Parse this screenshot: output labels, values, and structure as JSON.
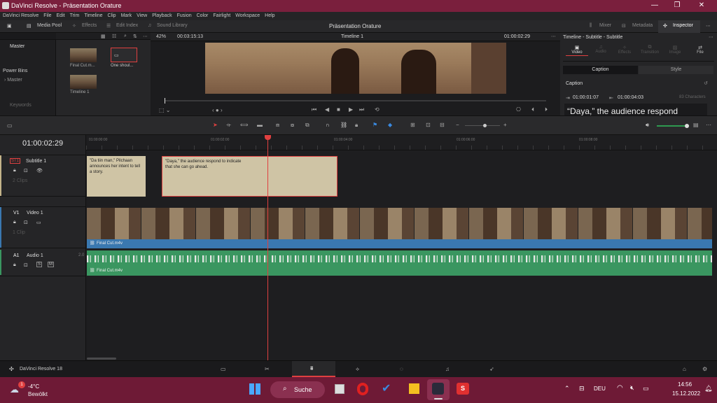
{
  "window": {
    "title": "DaVinci Resolve - Präsentation Orature"
  },
  "menu": [
    "DaVinci Resolve",
    "File",
    "Edit",
    "Trim",
    "Timeline",
    "Clip",
    "Mark",
    "View",
    "Playback",
    "Fusion",
    "Color",
    "Fairlight",
    "Workspace",
    "Help"
  ],
  "toolbar": {
    "media_pool": "Media Pool",
    "effects": "Effects",
    "edit_index": "Edit Index",
    "sound_library": "Sound Library",
    "project_name": "Präsentation Orature",
    "mixer": "Mixer",
    "metadata": "Metadata",
    "inspector": "Inspector"
  },
  "left_panel": {
    "master": "Master",
    "power_bins": "Power Bins",
    "power_master": "Master",
    "keywords": "Keywords"
  },
  "media_pool": {
    "items": [
      {
        "label": "Final Cut.m..."
      },
      {
        "label": "One shoul..."
      },
      {
        "label": "Timeline 1"
      }
    ]
  },
  "viewer": {
    "zoom": "42%",
    "timecode_left": "00:03:15:13",
    "timeline_name": "Timeline 1",
    "timecode_right": "01:00:02:29"
  },
  "inspector": {
    "header": "Timeline - Subtitle - Subtitle",
    "tabs": [
      "Video",
      "Audio",
      "Effects",
      "Transition",
      "Image",
      "File"
    ],
    "sub_tabs": [
      "Caption",
      "Style"
    ],
    "section": "Caption",
    "in_tc": "01:00:01:07",
    "out_tc": "01:00:04:03",
    "chars": "83 Characters",
    "caption_text": "“Daya,” the audience respond"
  },
  "timeline": {
    "current_tc": "01:00:02:29",
    "ruler": [
      "01:00:00:00",
      "01:00:02:00",
      "01:00:04:00",
      "01:00:06:00",
      "01:00:08:00"
    ],
    "tracks": {
      "subtitle": {
        "id": "ST1",
        "name": "Subtitle 1",
        "clips": "2 Clips"
      },
      "video": {
        "id": "V1",
        "name": "Video 1",
        "clips": "1 Clip"
      },
      "audio": {
        "id": "A1",
        "name": "Audio 1",
        "channels": "2.0"
      }
    },
    "subtitle_clips": [
      {
        "text": "\"Da tiin man,\" Pilchaan announces her intent to tell a story."
      },
      {
        "text": "\"Daya,\" the audience respond to indicate that she can go ahead."
      }
    ],
    "video_clip_name": "Final Cut.m4v",
    "audio_clip_name": "Final Cut.m4v"
  },
  "pagebar": {
    "app_name": "DaVinci Resolve 18"
  },
  "taskbar": {
    "weather_temp": "-4°C",
    "weather_desc": "Bewölkt",
    "weather_badge": "1",
    "search_label": "Suche",
    "lang": "DEU",
    "time": "14:56",
    "date": "15.12.2022"
  },
  "colors": {
    "accent": "#e04040",
    "titlebar": "#7a1f3d",
    "video_clip": "#3a78b0",
    "audio_clip": "#3a9660",
    "subtitle_clip": "#cfc4a5"
  }
}
